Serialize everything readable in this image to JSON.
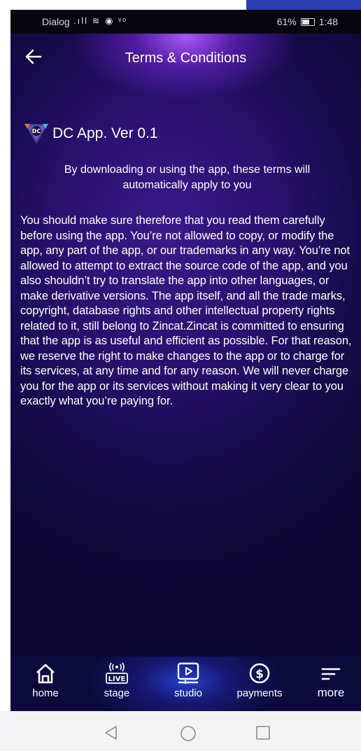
{
  "status_bar": {
    "carrier": "Dialog",
    "icons": ".ıll ≋ ◉ ᵛᵒ",
    "battery": "61%",
    "time": "1:48"
  },
  "header": {
    "title": "Terms & Conditions"
  },
  "content": {
    "app_title": "DC App. Ver 0.1",
    "intro": "By downloading or using the app, these terms will automatically apply to you",
    "body": "You should make sure therefore that you read them carefully before using the app. You’re not allowed to copy, or modify the app, any part of the app, or our trademarks in any way. You’re not allowed to attempt to extract the source code of the app, and you also shouldn’t try to translate the app into other languages, or make derivative versions. The app itself, and all the trade marks, copyright, database rights and other intellectual property rights related to it, still belong to Zincat.Zincat is committed to ensuring that the app is as useful and efficient as possible. For that reason, we reserve the right to make changes to the app or to charge for its services, at any time and for any reason. We will never charge you for the app or its services without making it very clear to you exactly what you’re paying for."
  },
  "bottom_nav": {
    "home": "home",
    "stage": "stage",
    "studio": "studio",
    "payments": "payments",
    "more": "more",
    "live_badge": "LIVE",
    "active": "studio"
  },
  "colors": {
    "background_dark": "#0b0833",
    "background_mid": "#2a1170",
    "glow": "#af5aff",
    "nav_glow": "#2846dc",
    "text": "#ffffff"
  },
  "icons": {
    "back": "arrow-left-icon",
    "home": "house-icon",
    "stage": "live-broadcast-icon",
    "studio": "play-screen-icon",
    "payments": "dollar-circle-icon",
    "more": "menu-lines-icon",
    "system_back": "triangle-back-icon",
    "system_home": "circle-home-icon",
    "system_recent": "square-recent-icon"
  }
}
